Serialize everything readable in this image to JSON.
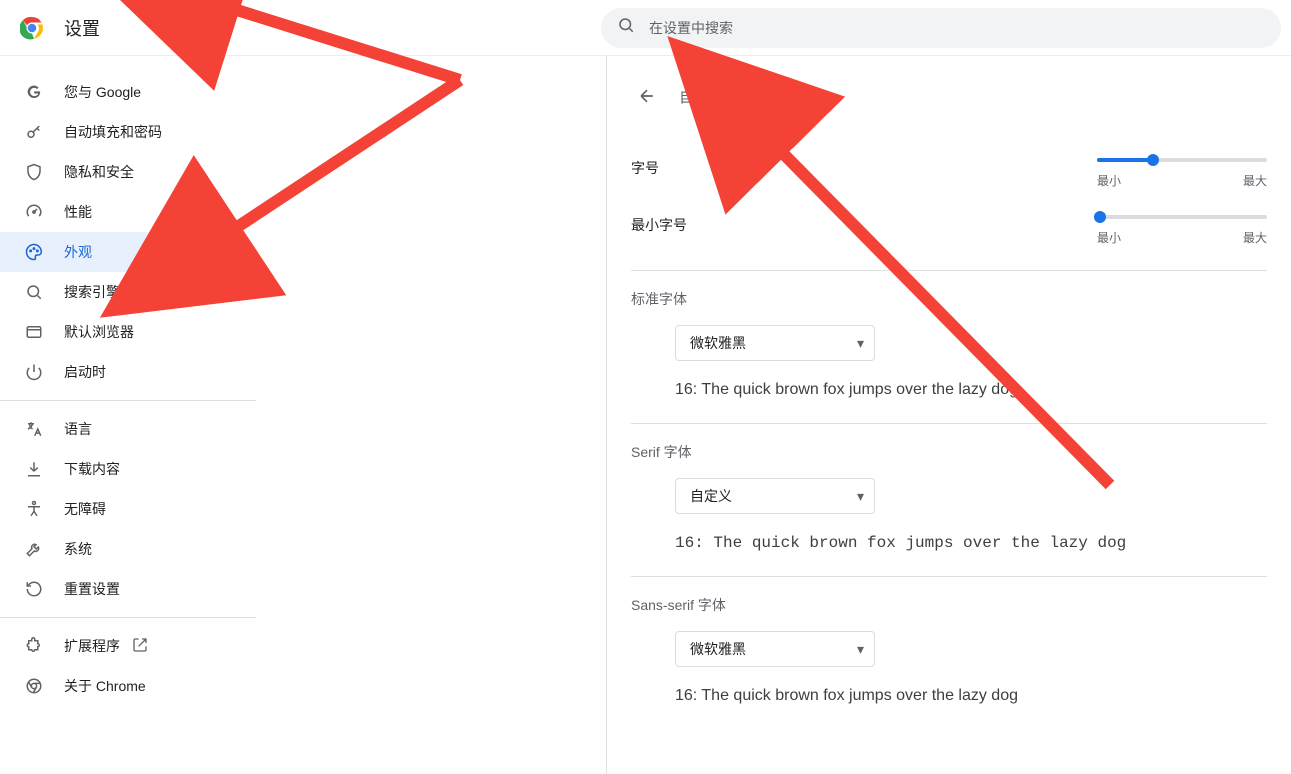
{
  "header": {
    "title": "设置",
    "search_placeholder": "在设置中搜索"
  },
  "sidebar": {
    "items": [
      {
        "id": "you-and-google",
        "label": "您与 Google"
      },
      {
        "id": "autofill",
        "label": "自动填充和密码"
      },
      {
        "id": "privacy",
        "label": "隐私和安全"
      },
      {
        "id": "performance",
        "label": "性能"
      },
      {
        "id": "appearance",
        "label": "外观",
        "active": true
      },
      {
        "id": "search-engine",
        "label": "搜索引擎"
      },
      {
        "id": "default-browser",
        "label": "默认浏览器"
      },
      {
        "id": "on-startup",
        "label": "启动时"
      }
    ],
    "secondary": [
      {
        "id": "languages",
        "label": "语言"
      },
      {
        "id": "downloads",
        "label": "下载内容"
      },
      {
        "id": "accessibility",
        "label": "无障碍"
      },
      {
        "id": "system",
        "label": "系统"
      },
      {
        "id": "reset",
        "label": "重置设置"
      }
    ],
    "footer": [
      {
        "id": "extensions",
        "label": "扩展程序",
        "external": true
      },
      {
        "id": "about",
        "label": "关于 Chrome"
      }
    ]
  },
  "content": {
    "page_title": "自定义字体",
    "font_size": {
      "label": "字号",
      "min_label": "最小",
      "max_label": "最大",
      "percent": 33
    },
    "min_font_size": {
      "label": "最小字号",
      "min_label": "最小",
      "max_label": "最大",
      "percent": 2
    },
    "standard_font": {
      "title": "标准字体",
      "selected": "微软雅黑",
      "preview": "16: The quick brown fox jumps over the lazy dog"
    },
    "serif_font": {
      "title": "Serif 字体",
      "selected": "自定义",
      "preview": "16: The quick brown fox jumps over the lazy dog"
    },
    "sans_font": {
      "title": "Sans-serif 字体",
      "selected": "微软雅黑",
      "preview": "16: The quick brown fox jumps over the lazy dog"
    }
  }
}
